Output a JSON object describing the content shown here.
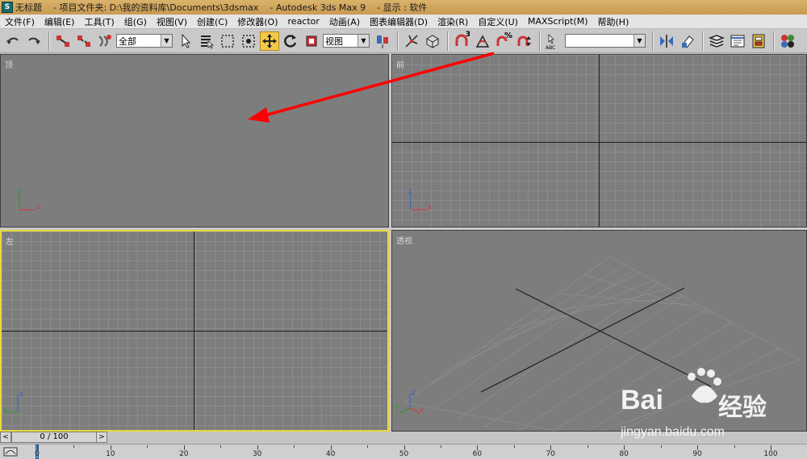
{
  "title": {
    "doc": "无标题",
    "project": "- 项目文件夹: D:\\我的资料库\\Documents\\3dsmax",
    "app": "- Autodesk 3ds Max 9",
    "display": "- 显示 : 软件"
  },
  "menu": [
    "文件(F)",
    "编辑(E)",
    "工具(T)",
    "组(G)",
    "视图(V)",
    "创建(C)",
    "修改器(O)",
    "reactor",
    "动画(A)",
    "图表编辑器(D)",
    "渲染(R)",
    "自定义(U)",
    "MAXScript(M)",
    "帮助(H)"
  ],
  "toolbar": {
    "selection_filter": "全部",
    "ref_coord": "视图",
    "named_selection": "",
    "snap_label": "3",
    "percent_label": "%",
    "abc_label": "ABC"
  },
  "viewports": {
    "top": "顶",
    "front": "前",
    "left": "左",
    "perspective": "透视"
  },
  "gizmo": {
    "x": "x",
    "y": "y",
    "z": "z"
  },
  "timeslider": {
    "counter": "0 / 100",
    "prev": "<",
    "next": ">"
  },
  "trackbar": {
    "ticks": [
      "0",
      "10",
      "20",
      "30",
      "40",
      "50",
      "60",
      "70",
      "80",
      "90",
      "100"
    ]
  },
  "watermark": {
    "brand": "Bai",
    "brand2": "经验",
    "url": "jingyan.baidu.com"
  },
  "colors": {
    "active_viewport": "#e8d83c",
    "viewport_bg": "#7d7d7d",
    "arrow": "#ff0000",
    "active_tool": "#f3c84a"
  }
}
